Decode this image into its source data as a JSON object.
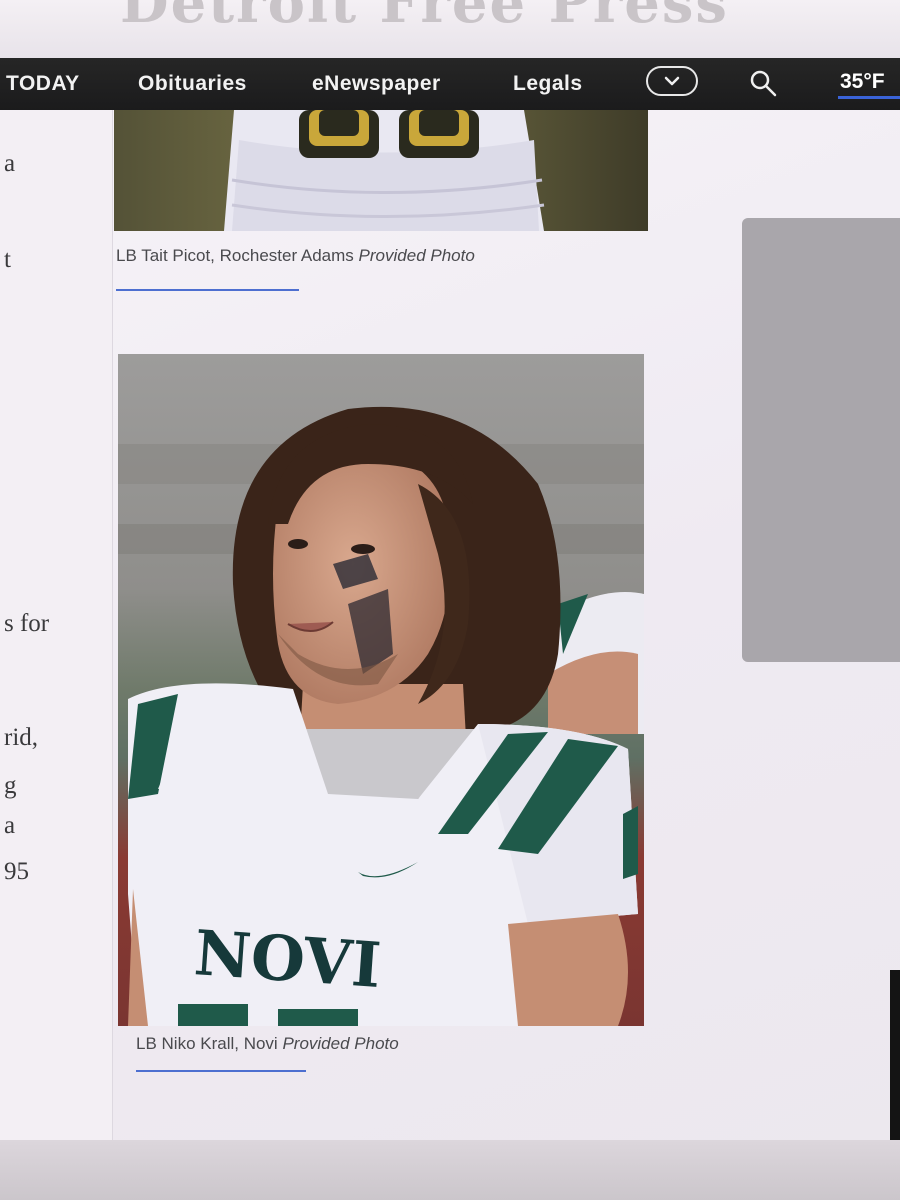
{
  "masthead": {
    "title": "Detroit Free Press"
  },
  "nav": {
    "items": [
      "TODAY",
      "Obituaries",
      "eNewspaper",
      "Legals"
    ],
    "dropdown_icon": "chevron-down-icon",
    "search_icon": "search-icon",
    "weather": "35°F"
  },
  "article": {
    "fragments": [
      "a",
      "t",
      "s for",
      "rid,",
      "g",
      "a",
      "95"
    ]
  },
  "photos": [
    {
      "caption": "LB Tait Picot, Rochester Adams",
      "credit": "Provided Photo"
    },
    {
      "caption": "LB Niko Krall, Novi",
      "credit": "Provided Photo",
      "jersey_text": "NOVI"
    }
  ],
  "colors": {
    "nav_bg": "#1e1e1f",
    "accent_blue": "#4d6fd0",
    "jersey_green": "#1f5a4a"
  }
}
